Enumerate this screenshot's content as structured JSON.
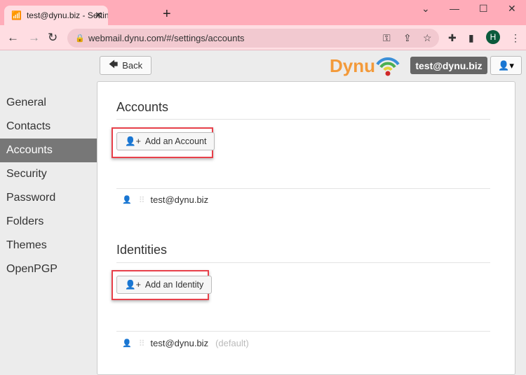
{
  "browser": {
    "tab_title": "test@dynu.biz - Settings - Dynu W",
    "url": "webmail.dynu.com/#/settings/accounts",
    "profile_initial": "H"
  },
  "header": {
    "back_label": "Back",
    "logo": "Dynu",
    "user_email": "test@dynu.biz"
  },
  "sidebar": {
    "items": [
      {
        "label": "General"
      },
      {
        "label": "Contacts"
      },
      {
        "label": "Accounts",
        "active": true
      },
      {
        "label": "Security"
      },
      {
        "label": "Password"
      },
      {
        "label": "Folders"
      },
      {
        "label": "Themes"
      },
      {
        "label": "OpenPGP"
      }
    ]
  },
  "accounts": {
    "title": "Accounts",
    "add_label": "Add an Account",
    "items": [
      {
        "email": "test@dynu.biz"
      }
    ]
  },
  "identities": {
    "title": "Identities",
    "add_label": "Add an Identity",
    "items": [
      {
        "email": "test@dynu.biz",
        "tag": "(default)"
      }
    ]
  },
  "colors": {
    "highlight": "#e8404a",
    "active_sidebar": "#777777",
    "logo": "#f39a3a"
  }
}
